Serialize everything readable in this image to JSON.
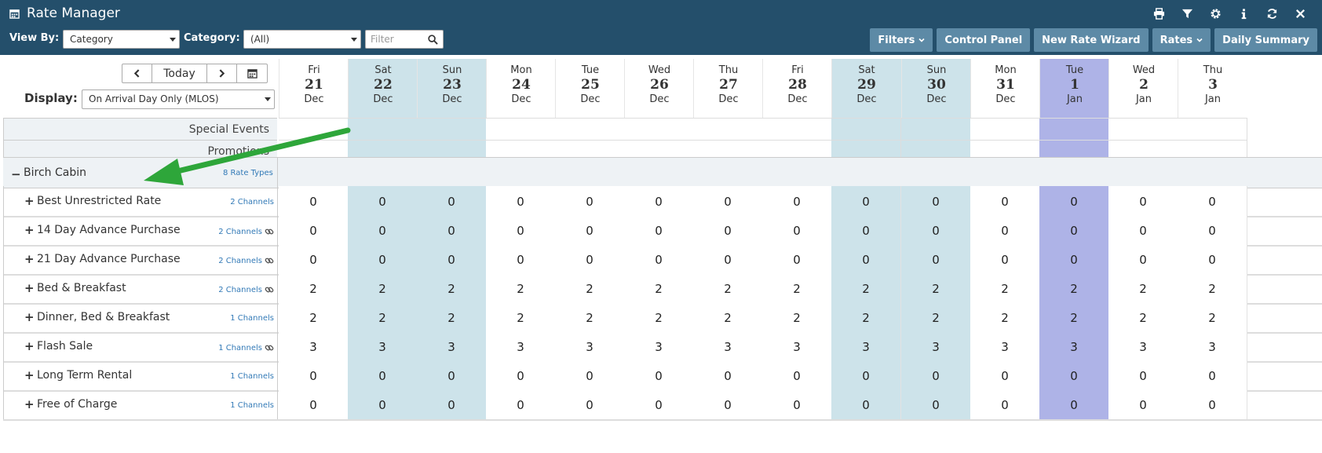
{
  "app": {
    "title": "Rate Manager"
  },
  "controls": {
    "view_by_label": "View By:",
    "view_by_value": "Category",
    "category_label": "Category:",
    "category_value": "(All)",
    "filter_placeholder": "Filter"
  },
  "toolbar": {
    "filters": "Filters",
    "control_panel": "Control Panel",
    "new_rate_wizard": "New Rate Wizard",
    "rates": "Rates",
    "daily_summary": "Daily Summary",
    "icons": [
      "print-icon",
      "funnel-icon",
      "gear-icon",
      "info-icon",
      "refresh-icon",
      "close-icon"
    ]
  },
  "nav": {
    "today": "Today"
  },
  "display": {
    "label": "Display:",
    "value": "On Arrival Day Only (MLOS)"
  },
  "dates": [
    {
      "dow": "Fri",
      "day": "21",
      "mon": "Dec",
      "kind": "normal"
    },
    {
      "dow": "Sat",
      "day": "22",
      "mon": "Dec",
      "kind": "weekend"
    },
    {
      "dow": "Sun",
      "day": "23",
      "mon": "Dec",
      "kind": "weekend"
    },
    {
      "dow": "Mon",
      "day": "24",
      "mon": "Dec",
      "kind": "normal"
    },
    {
      "dow": "Tue",
      "day": "25",
      "mon": "Dec",
      "kind": "normal"
    },
    {
      "dow": "Wed",
      "day": "26",
      "mon": "Dec",
      "kind": "normal"
    },
    {
      "dow": "Thu",
      "day": "27",
      "mon": "Dec",
      "kind": "normal"
    },
    {
      "dow": "Fri",
      "day": "28",
      "mon": "Dec",
      "kind": "normal"
    },
    {
      "dow": "Sat",
      "day": "29",
      "mon": "Dec",
      "kind": "weekend"
    },
    {
      "dow": "Sun",
      "day": "30",
      "mon": "Dec",
      "kind": "weekend"
    },
    {
      "dow": "Mon",
      "day": "31",
      "mon": "Dec",
      "kind": "normal"
    },
    {
      "dow": "Tue",
      "day": "1",
      "mon": "Jan",
      "kind": "today"
    },
    {
      "dow": "Wed",
      "day": "2",
      "mon": "Jan",
      "kind": "normal"
    },
    {
      "dow": "Thu",
      "day": "3",
      "mon": "Jan",
      "kind": "normal"
    }
  ],
  "events": [
    "Special Events",
    "Promotions"
  ],
  "category": {
    "name": "Birch Cabin",
    "rate_types": "8 Rate Types"
  },
  "rates": [
    {
      "name": "Best Unrestricted Rate",
      "channels": "2 Channels",
      "linked": false,
      "values": [
        "0",
        "0",
        "0",
        "0",
        "0",
        "0",
        "0",
        "0",
        "0",
        "0",
        "0",
        "0",
        "0",
        "0"
      ]
    },
    {
      "name": "14 Day Advance Purchase",
      "channels": "2 Channels",
      "linked": true,
      "values": [
        "0",
        "0",
        "0",
        "0",
        "0",
        "0",
        "0",
        "0",
        "0",
        "0",
        "0",
        "0",
        "0",
        "0"
      ]
    },
    {
      "name": "21 Day Advance Purchase",
      "channels": "2 Channels",
      "linked": true,
      "values": [
        "0",
        "0",
        "0",
        "0",
        "0",
        "0",
        "0",
        "0",
        "0",
        "0",
        "0",
        "0",
        "0",
        "0"
      ]
    },
    {
      "name": "Bed & Breakfast",
      "channels": "2 Channels",
      "linked": true,
      "values": [
        "2",
        "2",
        "2",
        "2",
        "2",
        "2",
        "2",
        "2",
        "2",
        "2",
        "2",
        "2",
        "2",
        "2"
      ]
    },
    {
      "name": "Dinner, Bed & Breakfast",
      "channels": "1 Channels",
      "linked": false,
      "values": [
        "2",
        "2",
        "2",
        "2",
        "2",
        "2",
        "2",
        "2",
        "2",
        "2",
        "2",
        "2",
        "2",
        "2"
      ]
    },
    {
      "name": "Flash Sale",
      "channels": "1 Channels",
      "linked": true,
      "values": [
        "3",
        "3",
        "3",
        "3",
        "3",
        "3",
        "3",
        "3",
        "3",
        "3",
        "3",
        "3",
        "3",
        "3"
      ]
    },
    {
      "name": "Long Term Rental",
      "channels": "1 Channels",
      "linked": false,
      "values": [
        "0",
        "0",
        "0",
        "0",
        "0",
        "0",
        "0",
        "0",
        "0",
        "0",
        "0",
        "0",
        "0",
        "0"
      ]
    },
    {
      "name": "Free of Charge",
      "channels": "1 Channels",
      "linked": false,
      "values": [
        "0",
        "0",
        "0",
        "0",
        "0",
        "0",
        "0",
        "0",
        "0",
        "0",
        "0",
        "0",
        "0",
        "0"
      ]
    }
  ],
  "colors": {
    "header": "#244f6b",
    "button": "#5d8aa6",
    "weekend": "#cde3ea",
    "today": "#aeb3e7",
    "arrow": "#2ea63a"
  }
}
